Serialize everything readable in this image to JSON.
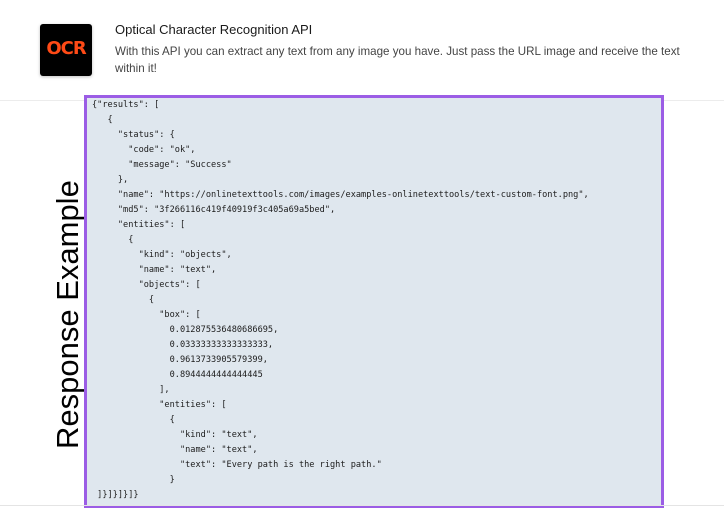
{
  "api": {
    "logo_text": "OCR",
    "title": "Optical Character Recognition API",
    "description": "With this API you can extract any text from any image you have. Just pass the URL image and receive the text within it!"
  },
  "response_example": {
    "label": "Response Example",
    "code_lines": [
      "{\"results\": [",
      "   {",
      "     \"status\": {",
      "       \"code\": \"ok\",",
      "       \"message\": \"Success\"",
      "     },",
      "     \"name\": \"https://onlinetexttools.com/images/examples-onlinetexttools/text-custom-font.png\",",
      "     \"md5\": \"3f266116c419f40919f3c405a69a5bed\",",
      "     \"entities\": [",
      "       {",
      "         \"kind\": \"objects\",",
      "         \"name\": \"text\",",
      "         \"objects\": [",
      "           {",
      "             \"box\": [",
      "               0.012875536480686695,",
      "               0.03333333333333333,",
      "               0.9613733905579399,",
      "               0.8944444444444445",
      "             ],",
      "             \"entities\": [",
      "               {",
      "                 \"kind\": \"text\",",
      "                 \"name\": \"text\",",
      "                 \"text\": \"Every path is the right path.\"",
      "               }",
      " ]}]}]}]}"
    ]
  },
  "colors": {
    "code_background": "#dfe7ee",
    "code_border": "#9b5de5",
    "logo_background": "#000000",
    "logo_text": "#ff4a16"
  }
}
